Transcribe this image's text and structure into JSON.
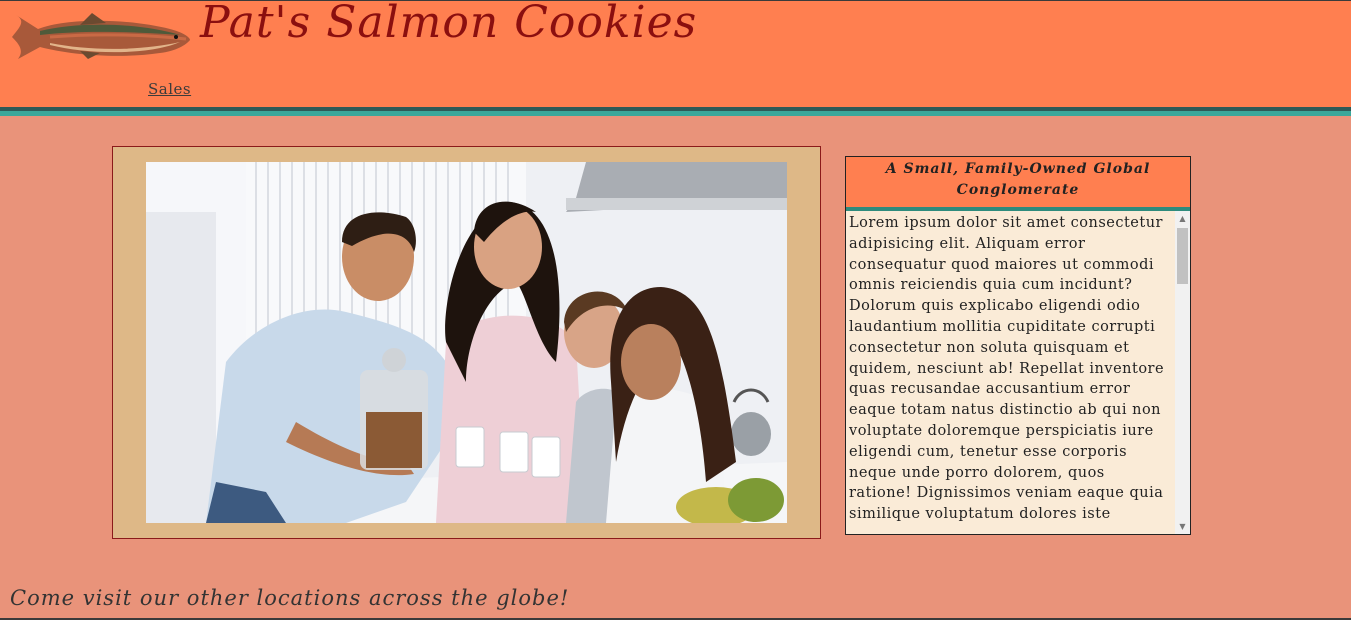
{
  "header": {
    "title": "Pat's Salmon Cookies",
    "logo_icon": "salmon-fish-icon",
    "nav": [
      {
        "label": "Sales"
      }
    ]
  },
  "main": {
    "photo_icon": "family-photo",
    "sidebar": {
      "heading": "A Small, Family-Owned Global Conglomerate",
      "body": "Lorem ipsum dolor sit amet consectetur adipisicing elit. Aliquam error consequatur quod maiores ut commodi omnis reiciendis quia cum incidunt? Dolorum quis explicabo eligendi odio laudantium mollitia cupiditate corrupti consectetur non soluta quisquam et quidem, nesciunt ab! Repellat inventore quas recusandae accusantium error eaque totam natus distinctio ab qui non voluptate doloremque perspiciatis iure eligendi cum, tenetur esse corporis neque unde porro dolorem, quos ratione! Dignissimos veniam eaque quia similique voluptatum dolores iste"
    }
  },
  "footer": {
    "text": "Come visit our other locations across the globe!"
  },
  "colors": {
    "header_bg": "#ff7f50",
    "page_bg": "#e9937a",
    "title": "#8b0f0f",
    "frame": "#deb887",
    "sidebar_bg": "#faebd7"
  }
}
